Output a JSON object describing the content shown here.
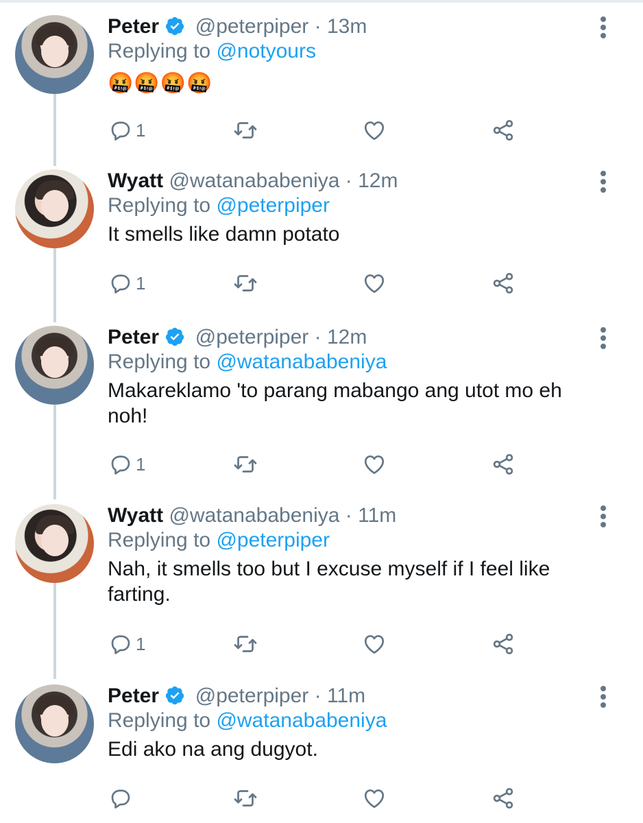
{
  "colors": {
    "accent": "#1da1f2",
    "muted": "#657786",
    "text": "#14171a",
    "thread": "#ccd6dd"
  },
  "icons": {
    "reply": "reply-icon",
    "retweet": "retweet-icon",
    "like": "heart-icon",
    "share": "share-icon",
    "more": "more-vertical-icon",
    "verified": "verified-badge-icon"
  },
  "tweets": [
    {
      "name": "Peter",
      "verified": true,
      "handle": "@peterpiper",
      "separator": "·",
      "time": "13m",
      "replying_prefix": "Replying to",
      "replying_to": "@notyours",
      "text": "",
      "emojis": "🤬🤬🤬🤬",
      "reply_count": "1"
    },
    {
      "name": "Wyatt",
      "verified": false,
      "handle": "@watanababeniya",
      "separator": "·",
      "time": "12m",
      "replying_prefix": "Replying to",
      "replying_to": "@peterpiper",
      "text": "It smells like damn potato",
      "emojis": "",
      "reply_count": "1"
    },
    {
      "name": "Peter",
      "verified": true,
      "handle": "@peterpiper",
      "separator": "·",
      "time": "12m",
      "replying_prefix": "Replying to",
      "replying_to": "@watanababeniya",
      "text": "Makareklamo 'to parang mabango ang utot mo eh noh!",
      "emojis": "",
      "reply_count": "1"
    },
    {
      "name": "Wyatt",
      "verified": false,
      "handle": "@watanababeniya",
      "separator": "·",
      "time": "11m",
      "replying_prefix": "Replying to",
      "replying_to": "@peterpiper",
      "text": "Nah, it smells too but I excuse myself if I feel like farting.",
      "emojis": "",
      "reply_count": "1"
    },
    {
      "name": "Peter",
      "verified": true,
      "handle": "@peterpiper",
      "separator": "·",
      "time": "11m",
      "replying_prefix": "Replying to",
      "replying_to": "@watanababeniya",
      "text": "Edi ako na ang dugyot.",
      "emojis": "",
      "reply_count": ""
    }
  ]
}
